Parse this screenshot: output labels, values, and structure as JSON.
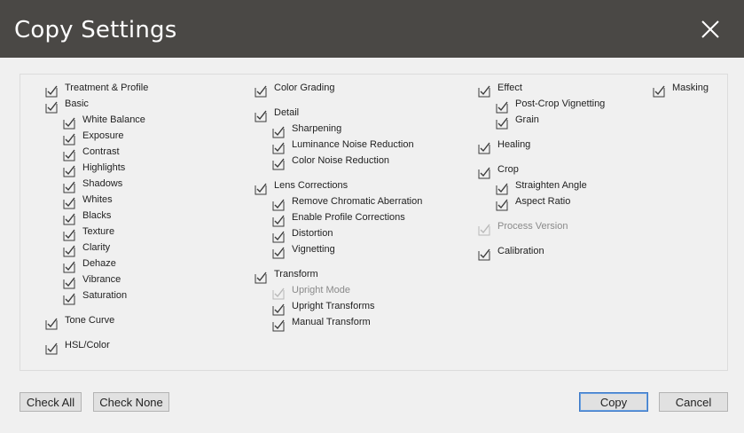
{
  "window": {
    "title": "Copy Settings"
  },
  "columns": [
    [
      {
        "label": "Treatment & Profile",
        "checked": true,
        "level": 0
      },
      {
        "label": "Basic",
        "checked": true,
        "level": 0
      },
      {
        "label": "White Balance",
        "checked": true,
        "level": 1
      },
      {
        "label": "Exposure",
        "checked": true,
        "level": 1
      },
      {
        "label": "Contrast",
        "checked": true,
        "level": 1
      },
      {
        "label": "Highlights",
        "checked": true,
        "level": 1
      },
      {
        "label": "Shadows",
        "checked": true,
        "level": 1
      },
      {
        "label": "Whites",
        "checked": true,
        "level": 1
      },
      {
        "label": "Blacks",
        "checked": true,
        "level": 1
      },
      {
        "label": "Texture",
        "checked": true,
        "level": 1
      },
      {
        "label": "Clarity",
        "checked": true,
        "level": 1
      },
      {
        "label": "Dehaze",
        "checked": true,
        "level": 1
      },
      {
        "label": "Vibrance",
        "checked": true,
        "level": 1
      },
      {
        "label": "Saturation",
        "checked": true,
        "level": 1
      },
      {
        "label": "Tone Curve",
        "checked": true,
        "level": 0,
        "gap": true
      },
      {
        "label": "HSL/Color",
        "checked": true,
        "level": 0,
        "gap": true
      }
    ],
    [
      {
        "label": "Color Grading",
        "checked": true,
        "level": 0
      },
      {
        "label": "Detail",
        "checked": true,
        "level": 0,
        "gap": true
      },
      {
        "label": "Sharpening",
        "checked": true,
        "level": 1
      },
      {
        "label": "Luminance Noise Reduction",
        "checked": true,
        "level": 1
      },
      {
        "label": "Color Noise Reduction",
        "checked": true,
        "level": 1
      },
      {
        "label": "Lens Corrections",
        "checked": true,
        "level": 0,
        "gap": true
      },
      {
        "label": "Remove Chromatic Aberration",
        "checked": true,
        "level": 1
      },
      {
        "label": "Enable Profile Corrections",
        "checked": true,
        "level": 1
      },
      {
        "label": "Distortion",
        "checked": true,
        "level": 1
      },
      {
        "label": "Vignetting",
        "checked": true,
        "level": 1
      },
      {
        "label": "Transform",
        "checked": true,
        "level": 0,
        "gap": true
      },
      {
        "label": "Upright Mode",
        "checked": true,
        "level": 1,
        "disabled": true
      },
      {
        "label": "Upright Transforms",
        "checked": true,
        "level": 1
      },
      {
        "label": "Manual Transform",
        "checked": true,
        "level": 1
      }
    ],
    [
      {
        "label": "Effect",
        "checked": true,
        "level": 0
      },
      {
        "label": "Post-Crop Vignetting",
        "checked": true,
        "level": 1
      },
      {
        "label": "Grain",
        "checked": true,
        "level": 1
      },
      {
        "label": "Healing",
        "checked": true,
        "level": 0,
        "gap": true
      },
      {
        "label": "Crop",
        "checked": true,
        "level": 0,
        "gap": true
      },
      {
        "label": "Straighten Angle",
        "checked": true,
        "level": 1
      },
      {
        "label": "Aspect Ratio",
        "checked": true,
        "level": 1
      },
      {
        "label": "Process Version",
        "checked": true,
        "level": 0,
        "disabled": true,
        "gap": true
      },
      {
        "label": "Calibration",
        "checked": true,
        "level": 0,
        "gap": true
      }
    ],
    [
      {
        "label": "Masking",
        "checked": true,
        "level": 0
      }
    ]
  ],
  "buttons": {
    "check_all": "Check All",
    "check_none": "Check None",
    "copy": "Copy",
    "cancel": "Cancel"
  },
  "icons": {
    "close": "close-icon",
    "checkbox": "checkmark-icon"
  },
  "colors": {
    "titlebar": "#4a4845",
    "primary_border": "#3b78c8"
  }
}
